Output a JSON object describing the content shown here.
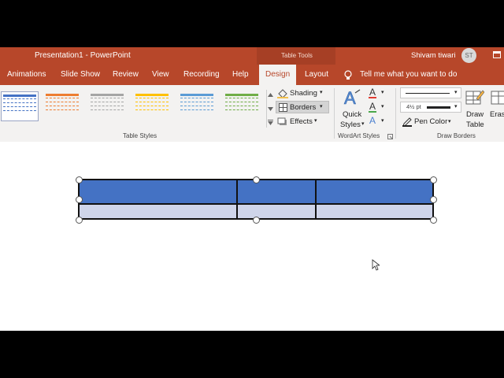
{
  "window": {
    "title": "Presentation1  -  PowerPoint",
    "context_tab_group": "Table Tools",
    "user_name": "Shivam tiwari",
    "user_initials": "ST"
  },
  "tabs": [
    {
      "label": "Animations"
    },
    {
      "label": "Slide Show"
    },
    {
      "label": "Review"
    },
    {
      "label": "View"
    },
    {
      "label": "Recording"
    },
    {
      "label": "Help"
    },
    {
      "label": "Design",
      "active": true
    },
    {
      "label": "Layout"
    }
  ],
  "tell_me": "Tell me what you want to do",
  "ribbon": {
    "table_styles_group": "Table Styles",
    "style_colors": [
      "#4472c4",
      "#ed7d31",
      "#a5a5a5",
      "#ffc000",
      "#5b9bd5",
      "#70ad47"
    ],
    "shading_label": "Shading",
    "borders_label": "Borders",
    "effects_label": "Effects",
    "quick_styles_label1": "Quick",
    "quick_styles_label2": "Styles",
    "wordart_group": "WordArt Styles",
    "pen_weight": "4½ pt",
    "pen_color_label": "Pen Color",
    "draw_table_label1": "Draw",
    "draw_table_label2": "Table",
    "eraser_label": "Eras",
    "draw_borders_group": "Draw Borders"
  },
  "table": {
    "header_color": "#4472c4",
    "body_color": "#cfd5ea"
  }
}
